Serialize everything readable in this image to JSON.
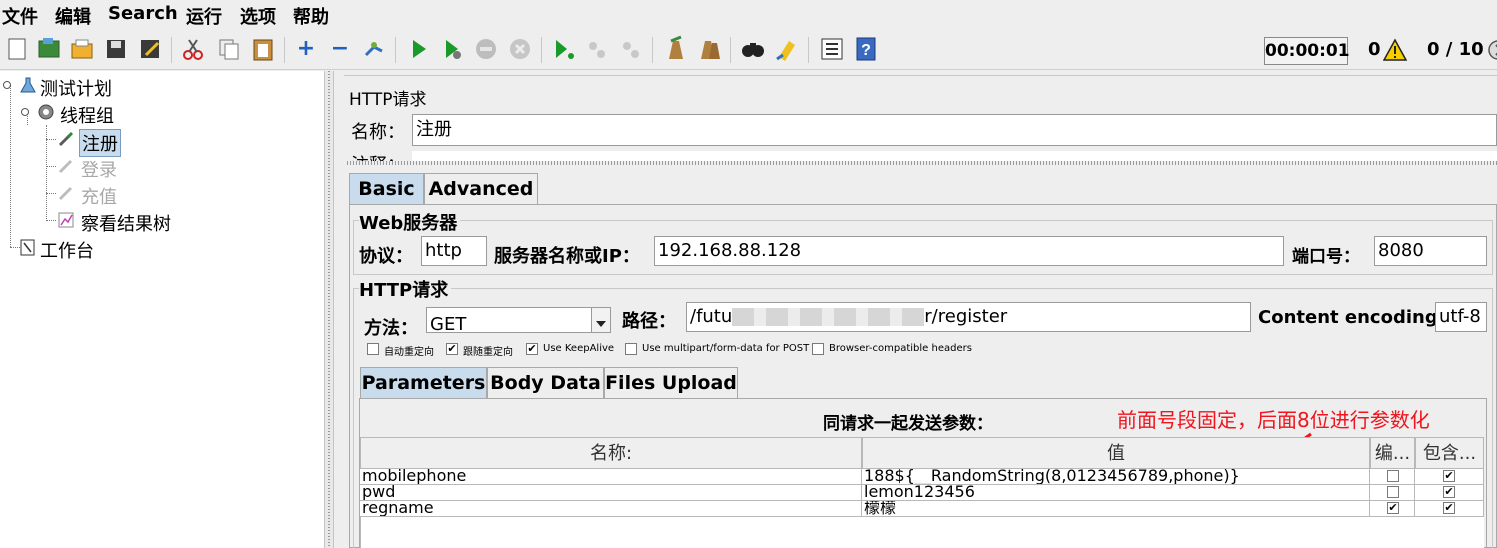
{
  "menu": [
    "文件",
    "编辑",
    "Search",
    "运行",
    "选项",
    "帮助"
  ],
  "toolbar": {
    "icons": [
      "new-icon",
      "templates-icon",
      "open-icon",
      "save-icon",
      "save-as-icon",
      "cut-icon",
      "copy-icon",
      "paste-icon",
      "expand-icon",
      "collapse-icon",
      "toggle-icon",
      "start-icon",
      "start-no-pause-icon",
      "stop-icon",
      "shutdown-icon",
      "remote-start-icon",
      "remote-stop-icon",
      "remote-shutdown-icon",
      "clear-icon",
      "clear-all-icon",
      "search-icon",
      "reset-search-icon",
      "function-helper-icon",
      "help-icon"
    ],
    "timer": "00:00:01",
    "warning_count": "0",
    "thread_count": "0 / 10"
  },
  "tree": {
    "test_plan": "测试计划",
    "thread_group": "线程组",
    "register": "注册",
    "login": "登录",
    "recharge": "充值",
    "result_tree": "察看结果树",
    "workbench": "工作台"
  },
  "sampler": {
    "title": "HTTP请求",
    "name_label": "名称：",
    "name_value": "注册",
    "comment_label": "注释："
  },
  "tabs": [
    "Basic",
    "Advanced"
  ],
  "web_server": {
    "section_title": "Web服务器",
    "protocol_label": "协议：",
    "protocol_value": "http",
    "server_label": "服务器名称或IP：",
    "server_value": "192.168.88.128",
    "port_label": "端口号：",
    "port_value": "8080"
  },
  "http_request": {
    "section_title": "HTTP请求",
    "method_label": "方法：",
    "method_value": "GET",
    "path_label": "路径：",
    "path_value": "/futu",
    "path_suffix": "r/register",
    "encoding_label": "Content encoding:",
    "encoding_value": "utf-8",
    "options": [
      {
        "label": "自动重定向",
        "checked": false
      },
      {
        "label": "跟随重定向",
        "checked": true
      },
      {
        "label": "Use KeepAlive",
        "checked": true
      },
      {
        "label": "Use multipart/form-data for POST",
        "checked": false
      },
      {
        "label": "Browser-compatible headers",
        "checked": false
      }
    ]
  },
  "param_tabs": [
    "Parameters",
    "Body Data",
    "Files Upload"
  ],
  "params": {
    "caption": "同请求一起发送参数：",
    "annotation": "前面号段固定，后面8位进行参数化",
    "columns": [
      "名称:",
      "值",
      "编...",
      "包含..."
    ],
    "rows": [
      {
        "name": "mobilephone",
        "value": "188${__RandomString(8,0123456789,phone)}",
        "encode": false,
        "include": true
      },
      {
        "name": "pwd",
        "value": "lemon123456",
        "encode": false,
        "include": true
      },
      {
        "name": "regname",
        "value": "檬檬",
        "encode": true,
        "include": true
      }
    ]
  },
  "colors": {
    "selected_node": "#c9dced",
    "annotation": "#f0141e"
  }
}
